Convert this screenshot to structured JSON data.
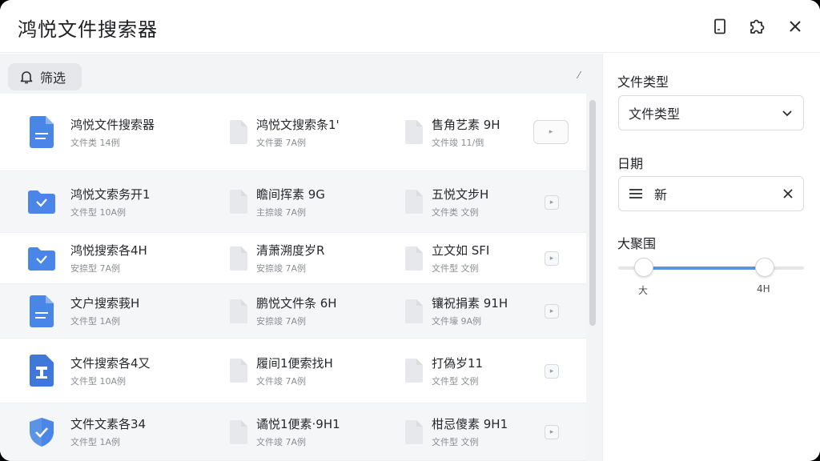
{
  "window": {
    "title": "鸿悦文件搜索器"
  },
  "toolbar": {
    "icons": [
      "bookmark-icon",
      "puzzle-icon",
      "close-icon"
    ]
  },
  "filter": {
    "label": "筛选"
  },
  "collapse_mark": "⁄",
  "rows": [
    {
      "cols": [
        {
          "name": "鸿悦文件搜索器",
          "meta": "文件类 14例",
          "icon": "doc-icon"
        },
        {
          "name": "鸿悦文搜索条1'",
          "meta": "文件要 7A例"
        },
        {
          "name": "售角艺素 9H",
          "meta": "文件竣 11/倒"
        }
      ]
    },
    {
      "cols": [
        {
          "name": "鸿悦文索务开1",
          "meta": "文件型 10A例",
          "icon": "folder-icon"
        },
        {
          "name": "瞻间挥素 9G",
          "meta": "主捺竣 7A例"
        },
        {
          "name": "五悦文步H",
          "meta": "文件类 文例"
        }
      ]
    },
    {
      "cols": [
        {
          "name": "鸿悦搜索各4H",
          "meta": "安捺型 7A例",
          "icon": "folder-icon"
        },
        {
          "name": "清萧溯度岁R",
          "meta": "安捺竣 7A例"
        },
        {
          "name": "立文如 SFI",
          "meta": "文件型 文例"
        }
      ]
    },
    {
      "cols": [
        {
          "name": "文户搜索莪H",
          "meta": "文件型 1A例",
          "icon": "doc-icon"
        },
        {
          "name": "鹏悦文件条 6H",
          "meta": "安捺竣 7A例"
        },
        {
          "name": "镶祝捐素 91H",
          "meta": "文件壕 9A例"
        }
      ]
    },
    {
      "cols": [
        {
          "name": "文件搜索各4又",
          "meta": "文件型 10A例",
          "icon": "archive-icon"
        },
        {
          "name": "履间1便索找H",
          "meta": "文件竣 7A例"
        },
        {
          "name": "打偽岁11",
          "meta": "文件型 文例"
        }
      ]
    },
    {
      "cols": [
        {
          "name": "文件文素各34",
          "meta": "文件型 1A例",
          "icon": "shield-icon"
        },
        {
          "name": "谲悦1便素·9H1",
          "meta": "文件竣 7A例"
        },
        {
          "name": "柑忌傻素 9H1",
          "meta": "文件型 文例"
        }
      ]
    }
  ],
  "sidebar": {
    "file_type_label": "文件类型",
    "file_type_value": "文件类型",
    "date_label": "日期",
    "date_value": "新",
    "range_label": "大聚围",
    "range_min_label": "大",
    "range_max_label": "4H",
    "range_low": 0.14,
    "range_high": 0.79
  },
  "colors": {
    "accent": "#5b93e6",
    "icon_blue": "#4a86e8"
  }
}
